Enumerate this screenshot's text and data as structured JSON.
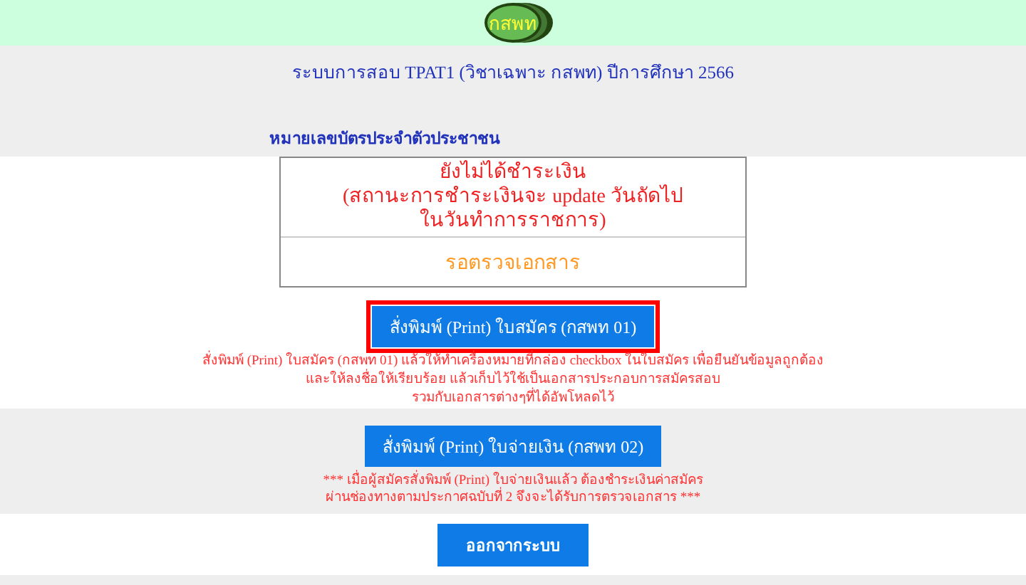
{
  "header": {
    "logo_text": "กสพท"
  },
  "title": "ระบบการสอบ TPAT1 (วิชาเฉพาะ กสพท) ปีการศึกษา 2566",
  "id_label": "หมายเลขบัตรประจำตัวประชาชน",
  "status_box": {
    "payment_lines": [
      "ยังไม่ได้ชำระเงิน",
      "(สถานะการชำระเงินจะ update วันถัดไป",
      "ในวันทำการราชการ)"
    ],
    "document_status": "รอตรวจเอกสาร"
  },
  "print_sections": [
    {
      "button": "สั่งพิมพ์ (Print) ใบสมัคร (กสพท 01)",
      "highlighted": true,
      "notes": [
        "สั่งพิมพ์ (Print) ใบสมัคร (กสพท 01) แล้วให้ทำเครื่องหมายที่กล่อง checkbox ในใบสมัคร เพื่อยืนยันข้อมูลถูกต้อง",
        "และให้ลงชื่อให้เรียบร้อย แล้วเก็บไว้ใช้เป็นเอกสารประกอบการสมัครสอบ",
        "รวมกับเอกสารต่างๆที่ได้อัพโหลดไว้"
      ]
    },
    {
      "button": "สั่งพิมพ์ (Print) ใบจ่ายเงิน (กสพท 02)",
      "highlighted": false,
      "notes": [
        "*** เมื่อผู้สมัครสั่งพิมพ์ (Print) ใบจ่ายเงินแล้ว ต้องชำระเงินค่าสมัคร",
        "ผ่านช่องทางตามประกาศฉบับที่ 2 จึงจะได้รับการตรวจเอกสาร ***"
      ]
    }
  ],
  "logout_button": "ออกจากระบบ"
}
